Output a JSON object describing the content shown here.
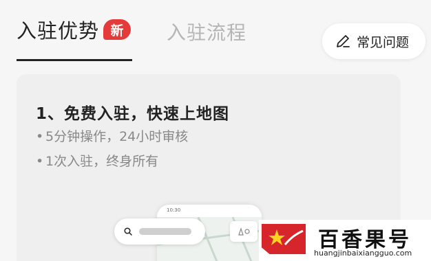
{
  "tabs": {
    "active_label": "入驻优势",
    "badge": "新",
    "inactive_label": "入驻流程"
  },
  "faq": {
    "label": "常见问题"
  },
  "card": {
    "title": "1、免费入驻，快速上地图",
    "bullets": [
      "5分钟操作，24小时审核",
      "1次入驻，终身所有"
    ],
    "bullet_mark": "•"
  },
  "phone": {
    "status_time": "10:30"
  },
  "watermark": {
    "name": "百香果号",
    "url": "huangjinbaixiangguo.com"
  },
  "colors": {
    "accent": "#e53a3a",
    "text": "#222222",
    "muted": "#888888",
    "inactive": "#b5b5b5"
  }
}
